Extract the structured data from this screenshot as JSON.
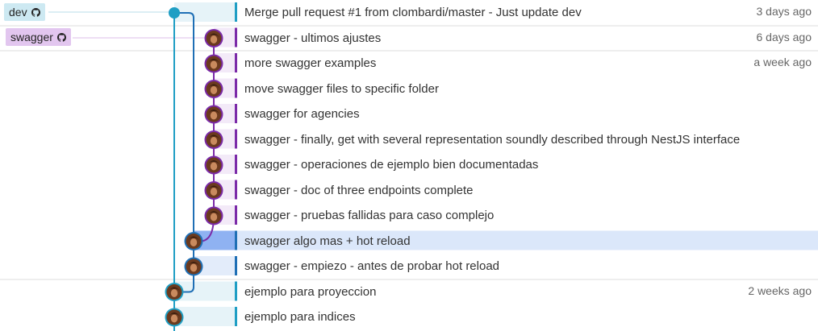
{
  "refs": [
    {
      "label": "dev",
      "icon": "github-icon",
      "color": "#cde9f2"
    },
    {
      "label": "swagger",
      "icon": "github-icon",
      "color": "#e2c6ef"
    }
  ],
  "commits": [
    {
      "message": "Merge pull request #1 from clombardi/master - Just update dev",
      "date": "3 days ago",
      "lane": 0,
      "avatar": false,
      "highlight": false
    },
    {
      "message": "swagger - ultimos ajustes",
      "date": "6 days ago",
      "lane": 2,
      "avatar": true,
      "highlight": false
    },
    {
      "message": "more swagger examples",
      "date": "a week ago",
      "lane": 2,
      "avatar": true,
      "highlight": false
    },
    {
      "message": "move swagger files to specific folder",
      "date": "",
      "lane": 2,
      "avatar": true,
      "highlight": false
    },
    {
      "message": "swagger for agencies",
      "date": "",
      "lane": 2,
      "avatar": true,
      "highlight": false
    },
    {
      "message": "swagger - finally, get with several representation soundly described through NestJS interface",
      "date": "",
      "lane": 2,
      "avatar": true,
      "highlight": false
    },
    {
      "message": "swagger - operaciones de ejemplo bien documentadas",
      "date": "",
      "lane": 2,
      "avatar": true,
      "highlight": false
    },
    {
      "message": "swagger - doc of three endpoints complete",
      "date": "",
      "lane": 2,
      "avatar": true,
      "highlight": false
    },
    {
      "message": "swagger - pruebas fallidas para caso complejo",
      "date": "",
      "lane": 2,
      "avatar": true,
      "highlight": false
    },
    {
      "message": "swagger algo mas + hot reload",
      "date": "",
      "lane": 1,
      "avatar": true,
      "highlight": true
    },
    {
      "message": "swagger - empiezo - antes de probar hot reload",
      "date": "",
      "lane": 1,
      "avatar": true,
      "highlight": false
    },
    {
      "message": "ejemplo para proyeccion",
      "date": "2 weeks ago",
      "lane": 0,
      "avatar": true,
      "highlight": false
    },
    {
      "message": "ejemplo para indices",
      "date": "",
      "lane": 0,
      "avatar": true,
      "highlight": false
    }
  ],
  "colors": {
    "lane0": "#1f9ec4",
    "lane1": "#1f6fb5",
    "lane2": "#7b2aa8",
    "highlight_row": "#dbe7fa",
    "highlight_bar": "#8fb2f2",
    "lane0_fill": "#e6f3f8",
    "lane1_fill": "#e3ecfa",
    "lane2_fill": "#f3eaf8",
    "separator": "#dddddd"
  }
}
